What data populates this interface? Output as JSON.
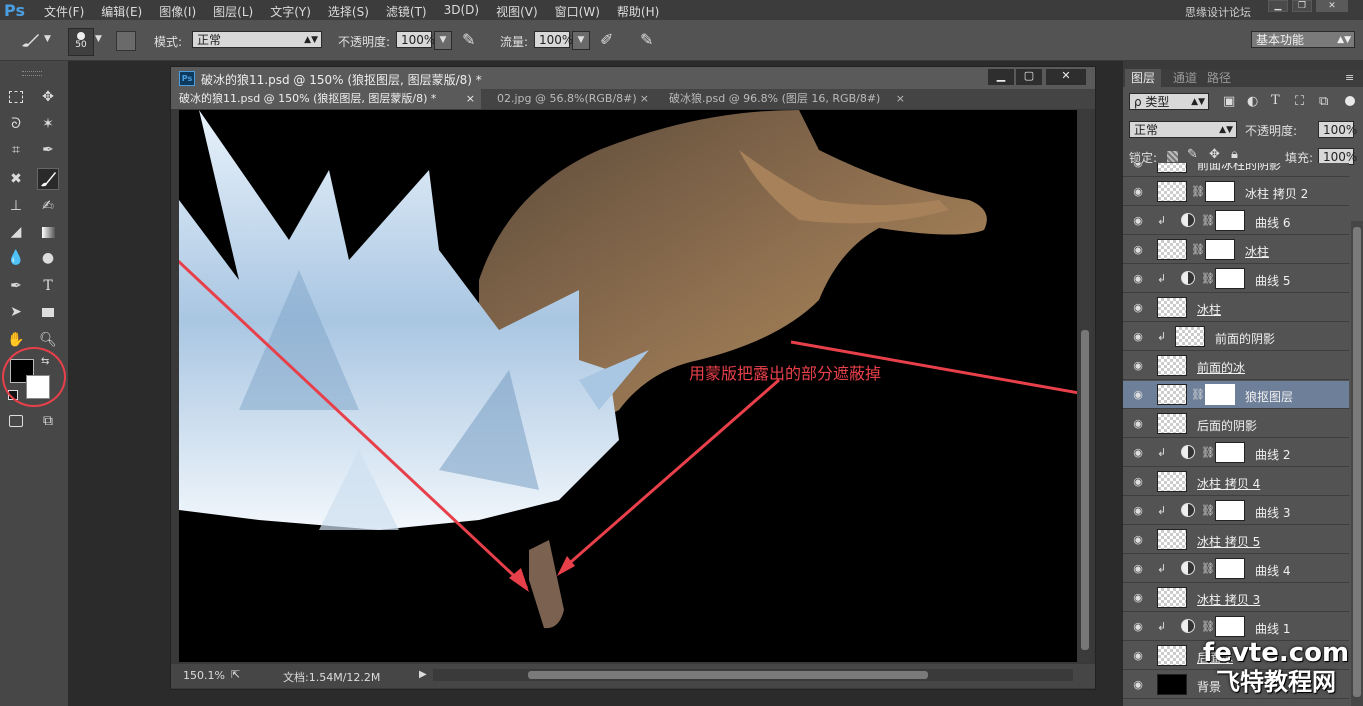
{
  "app": {
    "logo": "Ps",
    "menus": [
      "文件(F)",
      "编辑(E)",
      "图像(I)",
      "图层(L)",
      "文字(Y)",
      "选择(S)",
      "滤镜(T)",
      "3D(D)",
      "视图(V)",
      "窗口(W)",
      "帮助(H)"
    ],
    "watermark_top": "思缘设计论坛 www.missyuan.com",
    "workspace": "基本功能"
  },
  "options": {
    "brush_size": "50",
    "mode_label": "模式:",
    "mode_value": "正常",
    "opacity_label": "不透明度:",
    "opacity_value": "100%",
    "flow_label": "流量:",
    "flow_value": "100%"
  },
  "document": {
    "title": "破冰的狼11.psd @ 150% (狼抠图层, 图层蒙版/8) *",
    "tabs": [
      {
        "label": "破冰的狼11.psd @ 150% (狼抠图层, 图层蒙版/8) *",
        "active": true
      },
      {
        "label": "02.jpg @ 56.8%(RGB/8#)",
        "active": false
      },
      {
        "label": "破冰狼.psd @ 96.8% (图层 16, RGB/8#)",
        "active": false
      }
    ],
    "annotation": "用蒙版把露出的部分遮蔽掉",
    "annotation_color": "#e8404a",
    "zoom": "150.1%",
    "doc_size": "文档:1.54M/12.2M"
  },
  "panel": {
    "tabs": [
      "图层",
      "通道",
      "路径"
    ],
    "filter_kind": "ρ 类型",
    "blend_mode": "正常",
    "opacity_label": "不透明度:",
    "opacity_value": "100%",
    "lock_label": "锁定:",
    "fill_label": "填充:",
    "fill_value": "100%",
    "layers": [
      {
        "name": "前面冰柱的阴影",
        "clip": false,
        "adj": false,
        "mask": false,
        "underline": false,
        "selected": false
      },
      {
        "name": "冰柱 拷贝 2",
        "clip": false,
        "adj": false,
        "mask": true,
        "underline": false,
        "selected": false
      },
      {
        "name": "曲线 6",
        "clip": true,
        "adj": true,
        "mask": true,
        "underline": false,
        "selected": false
      },
      {
        "name": "冰柱",
        "clip": false,
        "adj": false,
        "mask": true,
        "underline": true,
        "selected": false
      },
      {
        "name": "曲线 5",
        "clip": true,
        "adj": true,
        "mask": true,
        "underline": false,
        "selected": false
      },
      {
        "name": "冰柱",
        "clip": false,
        "adj": false,
        "mask": false,
        "underline": true,
        "selected": false
      },
      {
        "name": "前面的阴影",
        "clip": true,
        "adj": false,
        "mask": false,
        "underline": false,
        "selected": false
      },
      {
        "name": "前面的冰",
        "clip": false,
        "adj": false,
        "mask": false,
        "underline": true,
        "selected": false
      },
      {
        "name": "狼抠图层",
        "clip": false,
        "adj": false,
        "mask": true,
        "underline": false,
        "selected": true
      },
      {
        "name": "后面的阴影",
        "clip": false,
        "adj": false,
        "mask": false,
        "underline": false,
        "selected": false
      },
      {
        "name": "曲线 2",
        "clip": true,
        "adj": true,
        "mask": true,
        "underline": false,
        "selected": false
      },
      {
        "name": "冰柱 拷贝 4",
        "clip": false,
        "adj": false,
        "mask": false,
        "underline": true,
        "selected": false
      },
      {
        "name": "曲线 3",
        "clip": true,
        "adj": true,
        "mask": true,
        "underline": false,
        "selected": false
      },
      {
        "name": "冰柱 拷贝 5",
        "clip": false,
        "adj": false,
        "mask": false,
        "underline": true,
        "selected": false
      },
      {
        "name": "曲线 4",
        "clip": true,
        "adj": true,
        "mask": true,
        "underline": false,
        "selected": false
      },
      {
        "name": "冰柱 拷贝 3",
        "clip": false,
        "adj": false,
        "mask": false,
        "underline": true,
        "selected": false
      },
      {
        "name": "曲线 1",
        "clip": true,
        "adj": true,
        "mask": true,
        "underline": false,
        "selected": false
      },
      {
        "name": "后面冰",
        "clip": false,
        "adj": false,
        "mask": false,
        "underline": true,
        "selected": false
      },
      {
        "name": "背景",
        "clip": false,
        "adj": false,
        "mask": false,
        "underline": false,
        "selected": false
      }
    ]
  },
  "site_watermark": {
    "line1": "fevte.com",
    "line2": "飞特教程网"
  }
}
